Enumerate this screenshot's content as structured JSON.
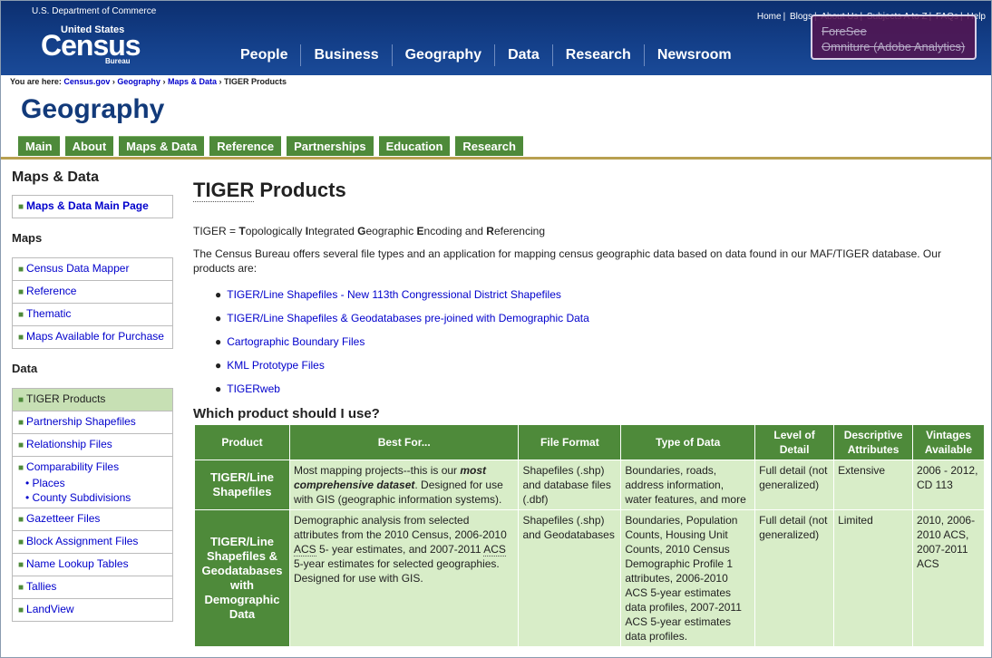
{
  "header": {
    "dept": "U.S. Department of Commerce",
    "logo_top": "United States",
    "logo_main": "Census",
    "logo_bottom": "Bureau",
    "utility": [
      "Home",
      "Blogs",
      "About Us",
      "Subjects A to Z",
      "FAQs",
      "Help"
    ],
    "nav": [
      "People",
      "Business",
      "Geography",
      "Data",
      "Research",
      "Newsroom"
    ]
  },
  "overlay": {
    "line1": "ForeSee",
    "line2": "Omniture (Adobe Analytics)"
  },
  "breadcrumb": {
    "prefix": "You are here:",
    "items": [
      "Census.gov",
      "Geography",
      "Maps & Data"
    ],
    "current": "TIGER Products",
    "sep": "›"
  },
  "section_title": "Geography",
  "subnav": [
    "Main",
    "About",
    "Maps & Data",
    "Reference",
    "Partnerships",
    "Education",
    "Research"
  ],
  "left": {
    "title": "Maps & Data",
    "main_link": "Maps & Data Main Page",
    "maps_heading": "Maps",
    "maps": [
      "Census Data Mapper",
      "Reference",
      "Thematic",
      "Maps Available for Purchase"
    ],
    "data_heading": "Data",
    "data": [
      "TIGER Products",
      "Partnership Shapefiles",
      "Relationship Files"
    ],
    "comparability": "Comparability Files",
    "comp_sub": [
      "Places",
      "County Subdivisions"
    ],
    "data2": [
      "Gazetteer Files",
      "Block Assignment Files",
      "Name Lookup Tables",
      "Tallies",
      "LandView"
    ]
  },
  "main": {
    "title_acr": "TIGER",
    "title_rest": " Products",
    "def": {
      "acr": "TIGER",
      "eq": " = ",
      "parts": [
        [
          "T",
          "opologically "
        ],
        [
          "I",
          "ntegrated "
        ],
        [
          "G",
          "eographic "
        ],
        [
          "E",
          "ncoding and "
        ],
        [
          "R",
          "eferencing"
        ]
      ]
    },
    "intro": "The Census Bureau offers several file types and an application for mapping census geographic data based on data found in our MAF/TIGER database. Our products are:",
    "links": [
      "TIGER/Line Shapefiles - New 113th Congressional District Shapefiles",
      "TIGER/Line Shapefiles & Geodatabases pre-joined with Demographic Data",
      "Cartographic Boundary Files",
      "KML Prototype Files",
      "TIGERweb"
    ],
    "which": "Which product should I use?"
  },
  "table": {
    "headers": [
      "Product",
      "Best For...",
      "File Format",
      "Type of Data",
      "Level of Detail",
      "Descriptive Attributes",
      "Vintages Available"
    ],
    "rows": [
      {
        "product": "TIGER/Line Shapefiles",
        "best_a": "Most mapping projects--this is our ",
        "best_em": "most comprehensive dataset",
        "best_b": ". Designed for use with GIS (geographic information systems).",
        "format": "Shapefiles (.shp) and database files (.dbf)",
        "type": "Boundaries, roads, address information, water features, and more",
        "detail": "Full detail (not generalized)",
        "attr": "Extensive",
        "vint": "2006 - 2012, CD 113"
      },
      {
        "product": "TIGER/Line Shapefiles & Geodatabases with Demographic Data",
        "best_a": "Demographic analysis from selected attributes from the 2010 Census, 2006-2010 ",
        "acs1": "ACS",
        "best_m": " 5- year estimates, and 2007-2011 ",
        "acs2": "ACS",
        "best_b": " 5-year estimates for selected geographies. Designed for use with GIS.",
        "format": "Shapefiles (.shp) and Geodatabases",
        "type": "Boundaries, Population Counts, Housing Unit Counts, 2010 Census Demographic Profile 1 attributes, 2006-2010 ACS 5-year estimates data profiles, 2007-2011 ACS 5-year estimates data profiles.",
        "detail": "Full detail (not generalized)",
        "attr": "Limited",
        "vint": "2010, 2006-2010 ACS, 2007-2011 ACS"
      }
    ]
  }
}
